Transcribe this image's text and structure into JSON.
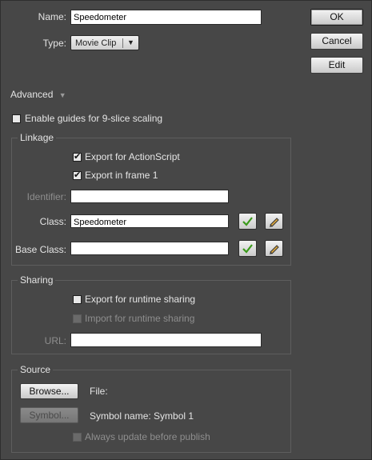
{
  "dialog": {
    "name_label": "Name:",
    "name_value": "Speedometer",
    "type_label": "Type:",
    "type_value": "Movie Clip",
    "buttons": {
      "ok": "OK",
      "cancel": "Cancel",
      "edit": "Edit"
    },
    "advanced_label": "Advanced",
    "nine_slice_label": "Enable guides for 9-slice scaling",
    "nine_slice_checked": false
  },
  "linkage": {
    "title": "Linkage",
    "export_actionscript_label": "Export for ActionScript",
    "export_actionscript_checked": true,
    "export_frame1_label": "Export in frame 1",
    "export_frame1_checked": true,
    "identifier_label": "Identifier:",
    "identifier_value": "",
    "class_label": "Class:",
    "class_value": "Speedometer",
    "base_class_label": "Base Class:",
    "base_class_value": ""
  },
  "sharing": {
    "title": "Sharing",
    "export_runtime_label": "Export for runtime sharing",
    "export_runtime_checked": false,
    "import_runtime_label": "Import for runtime sharing",
    "import_runtime_checked": false,
    "url_label": "URL:",
    "url_value": ""
  },
  "source": {
    "title": "Source",
    "browse_button": "Browse...",
    "file_label": "File:",
    "symbol_button": "Symbol...",
    "symbol_name_label": "Symbol name: Symbol 1",
    "always_update_label": "Always update before publish",
    "always_update_checked": false
  },
  "colors": {
    "check_icon": "#3a9a1a",
    "dialog_bg": "#474747"
  }
}
